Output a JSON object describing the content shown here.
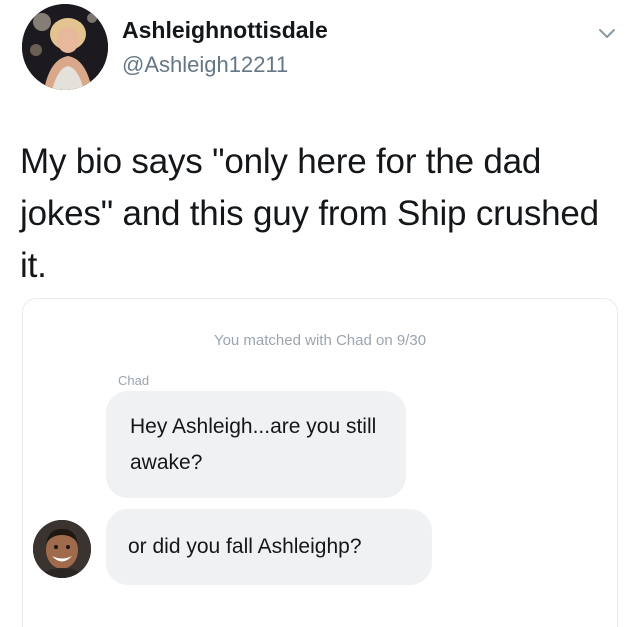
{
  "tweet": {
    "display_name": "Ashleighnottisdale",
    "handle": "@Ashleigh12211",
    "text": "My bio says \"only here for the dad jokes\" and this guy from Ship crushed it."
  },
  "chat": {
    "matched_note": "You matched with Chad on 9/30",
    "sender_name": "Chad",
    "messages": [
      {
        "text": "Hey Ashleigh...are you still awake?"
      },
      {
        "text": "or did you fall Ashleighp?"
      }
    ]
  },
  "colors": {
    "handle_gray": "#657786",
    "bubble_bg": "#f0f1f3",
    "note_gray": "#9aa5ae"
  },
  "icons": {
    "caret": "chevron-down-icon"
  }
}
